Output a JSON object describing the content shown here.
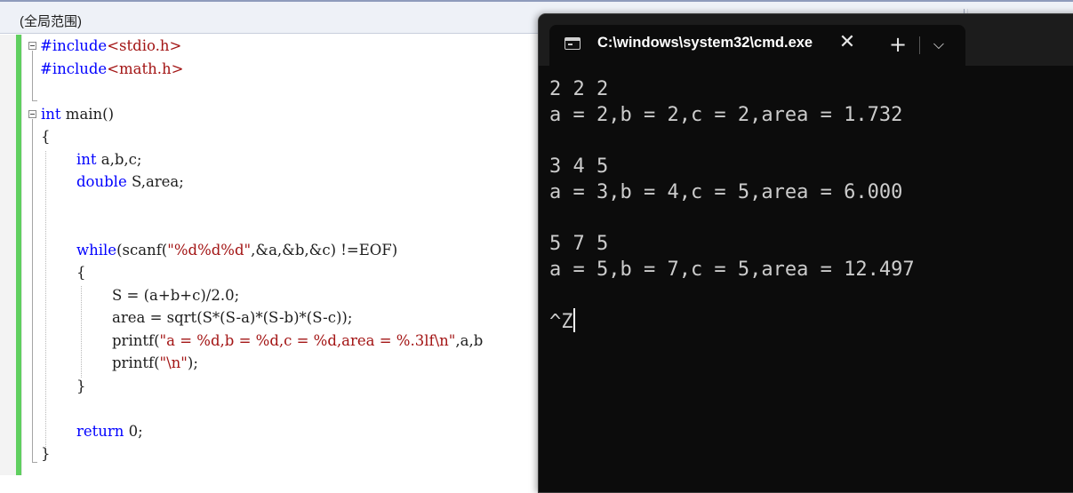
{
  "editor": {
    "scope_label": "(全局范围)",
    "code": {
      "include1": {
        "kw": "#include",
        "str": "<stdio.h>"
      },
      "include2": {
        "kw": "#include",
        "str": "<math.h>"
      },
      "main_kw": "int",
      "main_rest": " main()",
      "brace_open": "{",
      "decl1_kw": "int",
      "decl1_rest": " a,b,c;",
      "decl2_kw": "double",
      "decl2_rest": " S,area;",
      "while_kw": "while",
      "while_a": "(scanf(",
      "while_str": "\"%d%d%d\"",
      "while_b": ",&a,&b,&c) !=EOF)",
      "inner_open": "{",
      "line_s": "S = (a+b+c)/2.0;",
      "line_area": "area = sqrt(S*(S-a)*(S-b)*(S-c));",
      "printf1_a": "printf(",
      "printf1_str": "\"a = %d,b = %d,c = %d,area = %.3lf\\n\"",
      "printf1_b": ",a,b",
      "printf2_a": "printf(",
      "printf2_str": "\"\\n\"",
      "printf2_b": ");",
      "inner_close": "}",
      "return_kw": "return",
      "return_rest": " 0;",
      "brace_close": "}"
    }
  },
  "terminal": {
    "tab_title": "C:\\windows\\system32\\cmd.exe",
    "icon": "terminal-icon",
    "close_glyph": "✕",
    "new_tab_glyph": "+",
    "dropdown_glyph": "⌵",
    "output": [
      "2 2 2",
      "a = 2,b = 2,c = 2,area = 1.732",
      "",
      "3 4 5",
      "a = 3,b = 4,c = 5,area = 6.000",
      "",
      "5 7 5",
      "a = 5,b = 7,c = 5,area = 12.497",
      "",
      "^Z"
    ]
  },
  "colors": {
    "keyword": "#0000ff",
    "string": "#a31515",
    "change_bar": "#5fcf5f",
    "terminal_bg": "#0c0c0c",
    "terminal_text": "#cccccc"
  }
}
